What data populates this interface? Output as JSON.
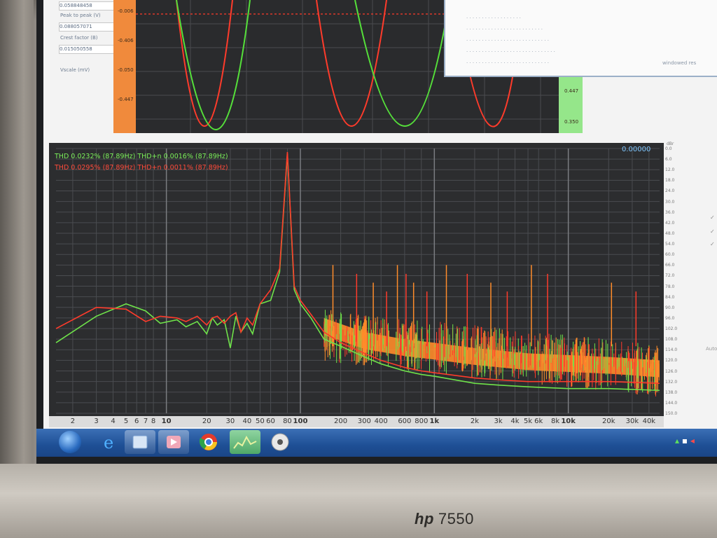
{
  "monitor": {
    "brand": "hp",
    "model": "7550"
  },
  "scope": {
    "left_panel": {
      "values": [
        "0.058848458",
        "0.088057071",
        "0.015050558"
      ],
      "labels": [
        "Peak to peak (V)",
        "Crest factor (B)",
        "Vscale (mV)"
      ]
    },
    "left_scale": [
      "-0.006",
      "-0.406",
      "-0.050",
      "-0.447"
    ],
    "right_scale": [
      "0.447",
      "0.350"
    ],
    "popup_right": "windowed res"
  },
  "spectrum": {
    "thd_green": "THD 0.0232% (87.89Hz) THD+n 0.0016% (87.89Hz)",
    "thd_red": "THD 0.0295% (87.89Hz) THD+n 0.0011% (87.89Hz)",
    "readout": "0.00000",
    "db_unit": "dBr",
    "db_ticks": [
      "0.0",
      "6.0",
      "12.0",
      "18.0",
      "24.0",
      "30.0",
      "36.0",
      "42.0",
      "48.0",
      "54.0",
      "60.0",
      "66.0",
      "72.0",
      "78.0",
      "84.0",
      "90.0",
      "96.0",
      "102.0",
      "108.0",
      "114.0",
      "120.0",
      "126.0",
      "132.0",
      "138.0",
      "144.0",
      "150.0"
    ],
    "side_label": "Auto"
  },
  "chart_data": {
    "type": "line",
    "xscale": "log",
    "xlim": [
      1.5,
      48000
    ],
    "ylim": [
      0,
      150
    ],
    "x_tick_labels": [
      "2",
      "3",
      "4",
      "5",
      "6",
      "7",
      "8",
      "10",
      "20",
      "30",
      "40",
      "50",
      "60",
      "80",
      "100",
      "200",
      "300",
      "400",
      "600",
      "800",
      "1k",
      "2k",
      "3k",
      "4k",
      "5k",
      "6k",
      "8k",
      "10k",
      "20k",
      "30k",
      "40k"
    ],
    "series": [
      {
        "color": "#6fe34a",
        "points": [
          [
            1.5,
            110
          ],
          [
            3,
            95
          ],
          [
            5,
            88
          ],
          [
            7,
            92
          ],
          [
            9,
            99
          ],
          [
            12,
            97
          ],
          [
            14,
            101
          ],
          [
            17,
            98
          ],
          [
            20,
            105
          ],
          [
            22,
            96
          ],
          [
            24,
            100
          ],
          [
            27,
            97
          ],
          [
            30,
            113
          ],
          [
            33,
            95
          ],
          [
            36,
            104
          ],
          [
            40,
            99
          ],
          [
            44,
            105
          ],
          [
            50,
            88
          ],
          [
            60,
            86
          ],
          [
            70,
            70
          ],
          [
            80,
            3
          ],
          [
            90,
            80
          ],
          [
            100,
            88
          ],
          [
            120,
            96
          ],
          [
            150,
            108
          ],
          [
            200,
            112
          ],
          [
            300,
            118
          ],
          [
            400,
            122
          ],
          [
            600,
            126
          ],
          [
            800,
            128
          ],
          [
            1000,
            129
          ],
          [
            2000,
            133
          ],
          [
            3000,
            134
          ],
          [
            5000,
            135
          ],
          [
            10000,
            136
          ],
          [
            20000,
            136
          ],
          [
            48000,
            137
          ]
        ]
      },
      {
        "color": "#ff3b2b",
        "points": [
          [
            1.5,
            102
          ],
          [
            3,
            90
          ],
          [
            5,
            91
          ],
          [
            7,
            98
          ],
          [
            9,
            95
          ],
          [
            12,
            96
          ],
          [
            14,
            98
          ],
          [
            17,
            95
          ],
          [
            20,
            100
          ],
          [
            22,
            96
          ],
          [
            24,
            95
          ],
          [
            27,
            99
          ],
          [
            30,
            95
          ],
          [
            33,
            93
          ],
          [
            36,
            104
          ],
          [
            40,
            96
          ],
          [
            44,
            100
          ],
          [
            50,
            88
          ],
          [
            60,
            80
          ],
          [
            70,
            68
          ],
          [
            80,
            2
          ],
          [
            90,
            78
          ],
          [
            100,
            86
          ],
          [
            120,
            94
          ],
          [
            150,
            104
          ],
          [
            200,
            110
          ],
          [
            300,
            116
          ],
          [
            400,
            120
          ],
          [
            600,
            124
          ],
          [
            800,
            126
          ],
          [
            1000,
            127
          ],
          [
            2000,
            130
          ],
          [
            3000,
            131
          ],
          [
            5000,
            132
          ],
          [
            10000,
            132
          ],
          [
            20000,
            132
          ],
          [
            48000,
            133
          ]
        ]
      },
      {
        "color": "#ff8c2a",
        "points": [
          [
            150,
            100
          ],
          [
            300,
            108
          ],
          [
            600,
            112
          ],
          [
            1000,
            114
          ],
          [
            2000,
            117
          ],
          [
            5000,
            120
          ],
          [
            10000,
            121
          ],
          [
            20000,
            122
          ],
          [
            48000,
            124
          ]
        ]
      }
    ]
  },
  "taskbar": {
    "apps": [
      "start-button",
      "ie-icon",
      "window-app",
      "media-player",
      "chrome",
      "spectrum-app",
      "disc-app"
    ]
  }
}
